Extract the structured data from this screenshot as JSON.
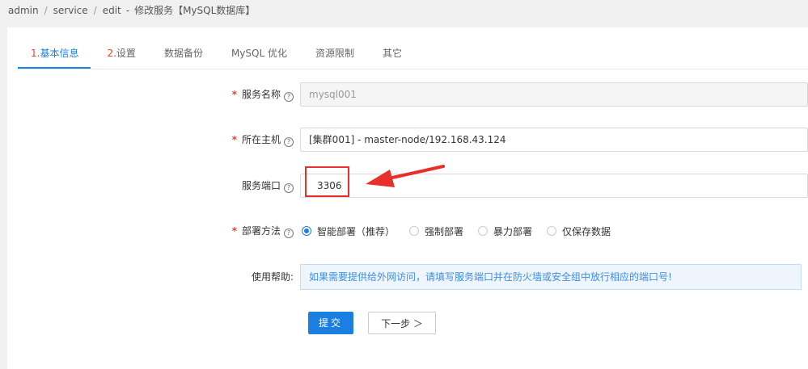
{
  "breadcrumb": {
    "items": [
      "admin",
      "service",
      "edit"
    ],
    "separator": "/",
    "title_dash": "-",
    "title": "修改服务【MySQL数据库】"
  },
  "tabs": [
    {
      "num": "1.",
      "label": "基本信息",
      "active": true
    },
    {
      "num": "2.",
      "label": "设置",
      "active": false
    },
    {
      "num": "",
      "label": "数据备份",
      "active": false
    },
    {
      "num": "",
      "label": "MySQL 优化",
      "active": false
    },
    {
      "num": "",
      "label": "资源限制",
      "active": false
    },
    {
      "num": "",
      "label": "其它",
      "active": false
    }
  ],
  "form": {
    "required_mark": "*",
    "help_glyph": "?",
    "service_name": {
      "label": "服务名称",
      "value": "mysql001"
    },
    "host": {
      "label": "所在主机",
      "value": "[集群001] - master-node/192.168.43.124"
    },
    "port": {
      "label": "服务端口",
      "value": "3306"
    },
    "deploy": {
      "label": "部署方法",
      "options": [
        "智能部署（推荐）",
        "强制部署",
        "暴力部署",
        "仅保存数据"
      ],
      "selected": "智能部署（推荐）"
    },
    "help": {
      "label": "使用帮助:",
      "text": "如果需要提供给外网访问，请填写服务端口并在防火墙或安全组中放行相应的端口号!"
    }
  },
  "buttons": {
    "submit": "提交",
    "next": "下一步 ＞"
  },
  "colors": {
    "accent": "#1a7fe0",
    "required": "#e8402a",
    "annotation": "#e8302a"
  }
}
